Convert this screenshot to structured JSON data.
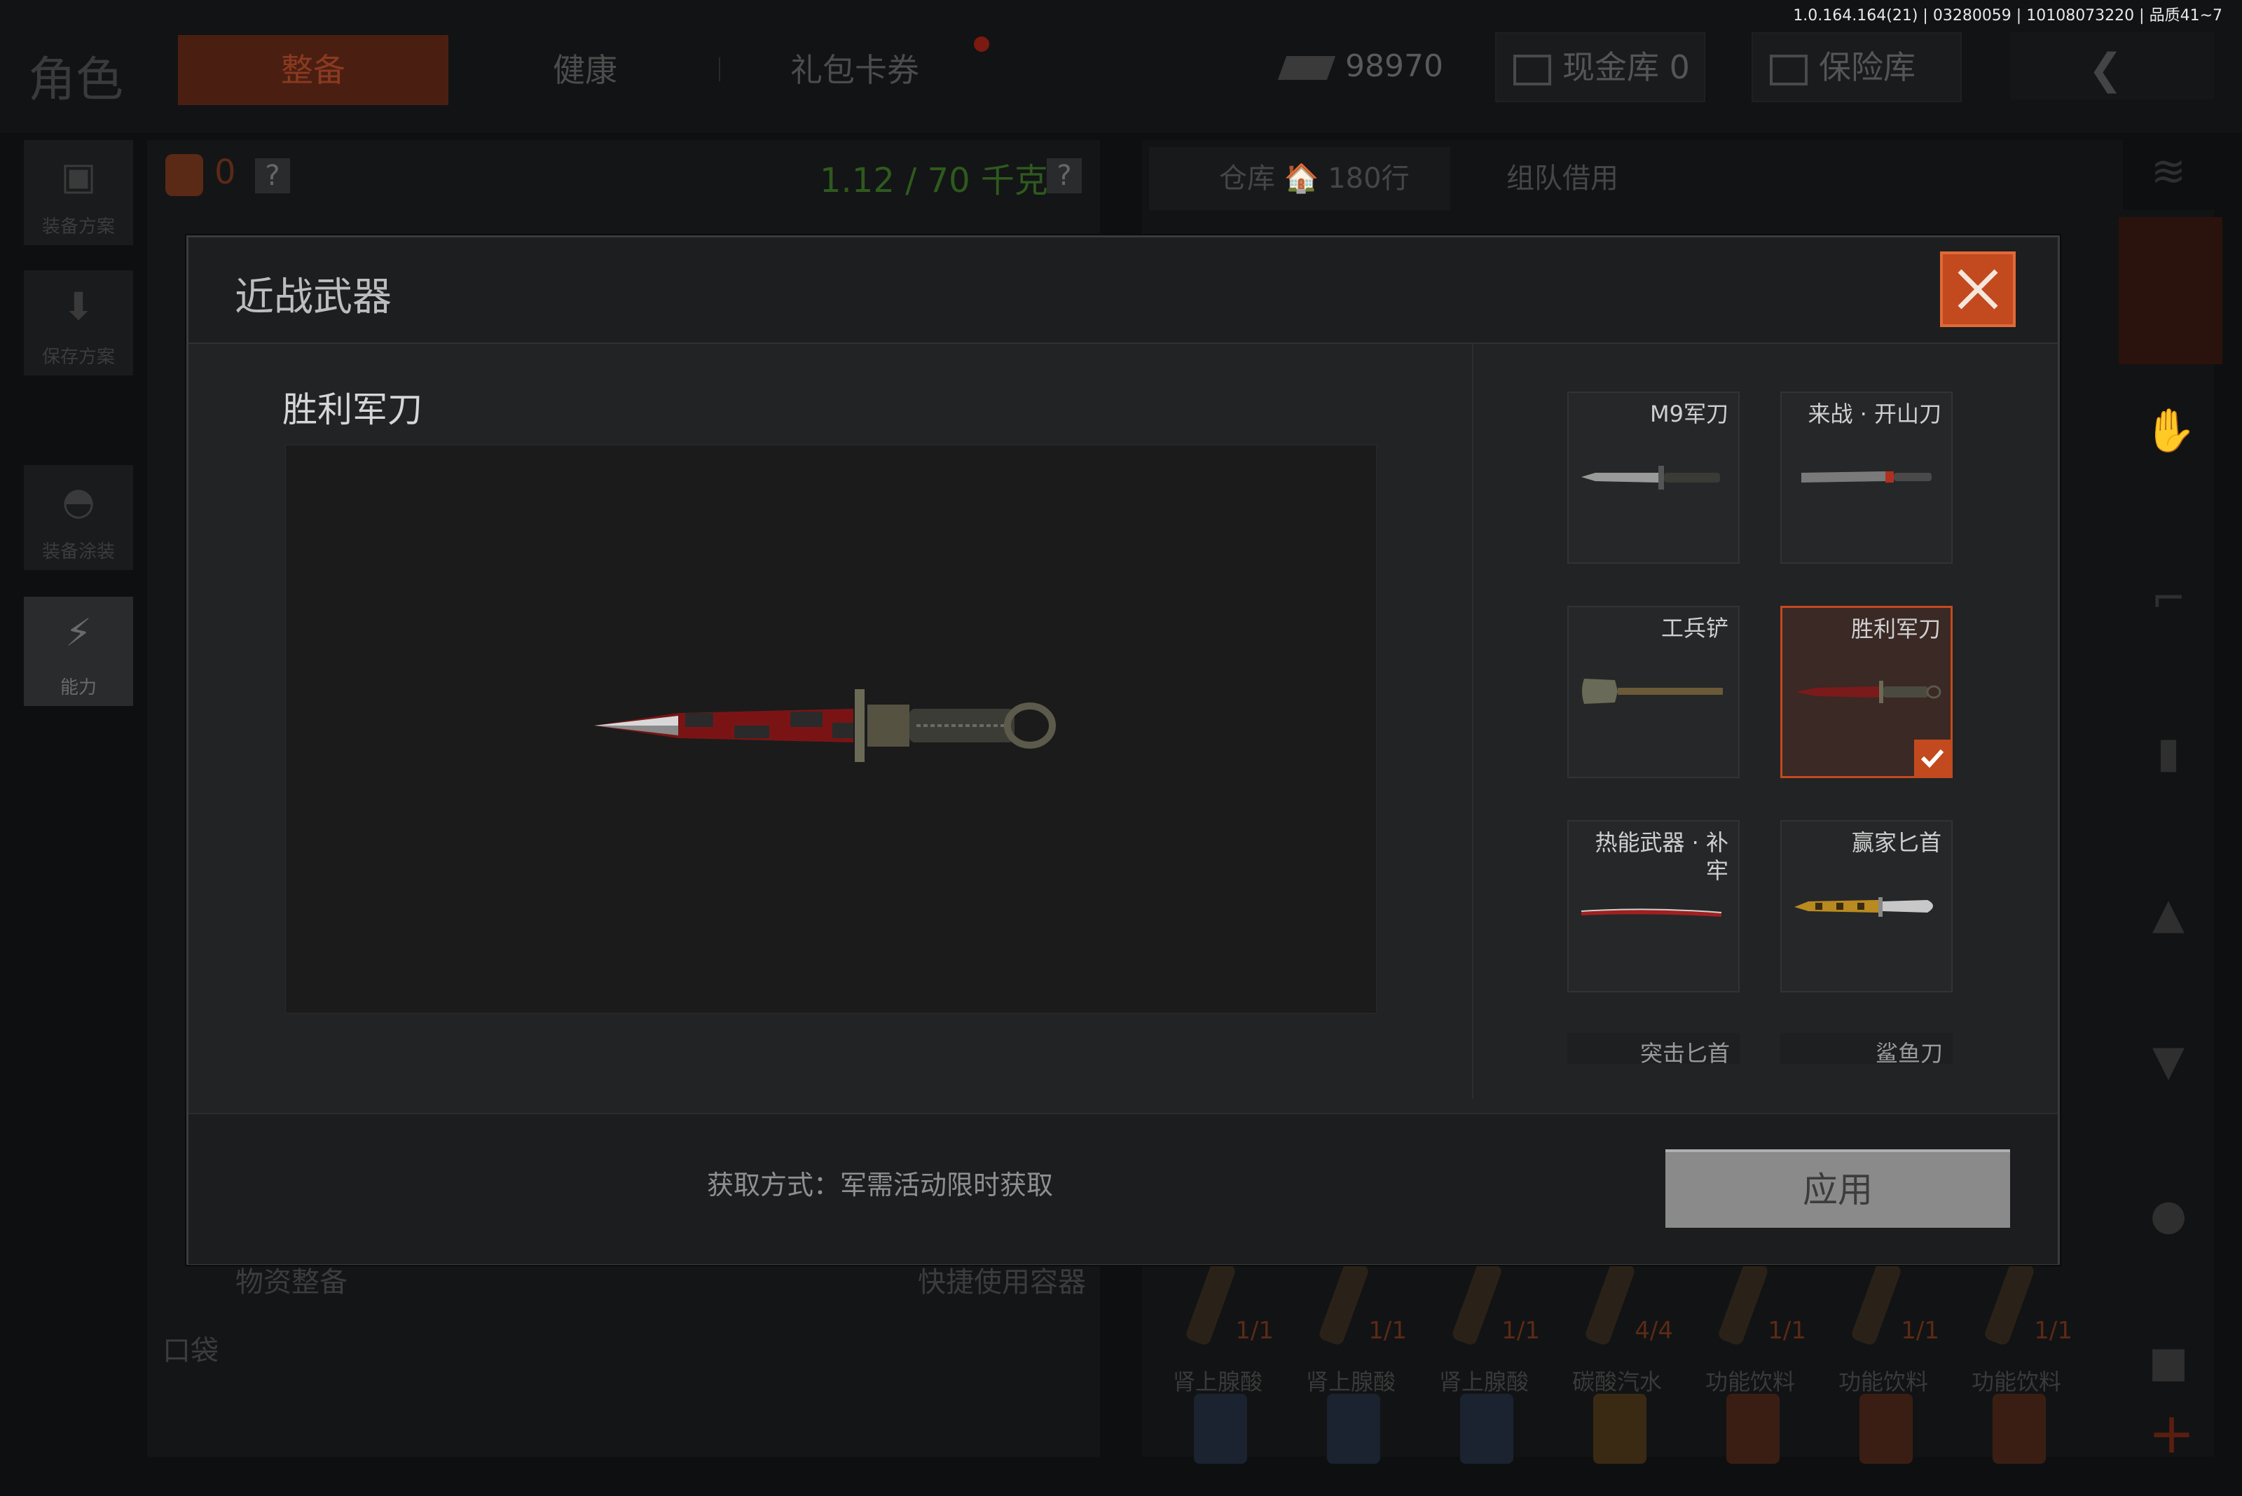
{
  "version_info": "1.0.164.164(21) | 03280059 | 10108073220 | 品质41~7",
  "header": {
    "role_title": "角色",
    "tabs": [
      {
        "label": "整备",
        "active": true
      },
      {
        "label": "健康",
        "active": false
      },
      {
        "label": "礼包卡券",
        "active": false
      }
    ],
    "money": "98970",
    "cash_vault": "现金库 0",
    "safe_box": "保险库"
  },
  "left_sidebar": {
    "items": [
      {
        "label": "装备方案",
        "icon": "vest-icon"
      },
      {
        "label": "保存方案",
        "icon": "download-icon"
      },
      {
        "label": "装备涂装",
        "icon": "helmet-icon"
      },
      {
        "label": "能力",
        "icon": "lightning-icon"
      }
    ]
  },
  "equipment": {
    "bag_count": "0",
    "help": "?",
    "weight": "1.12 / 70 千克",
    "supply_label": "物资整备",
    "quick_container": "快捷使用容器",
    "pocket_label": "口袋"
  },
  "warehouse": {
    "tabs": [
      "仓库 🏠 180行",
      "组队借用"
    ],
    "supply_counts": [
      "1/1",
      "1/1",
      "1/1",
      "4/4",
      "1/1",
      "1/1",
      "1/1"
    ],
    "drinks": [
      "肾上腺酸",
      "肾上腺酸",
      "肾上腺酸",
      "碳酸汽水",
      "功能饮料",
      "功能饮料",
      "功能饮料"
    ]
  },
  "modal": {
    "title": "近战武器",
    "selected_weapon": "胜利军刀",
    "weapons": [
      {
        "name": "M9军刀",
        "selected": false
      },
      {
        "name": "来战 · 开山刀",
        "selected": false
      },
      {
        "name": "工兵铲",
        "selected": false
      },
      {
        "name": "胜利军刀",
        "selected": true
      },
      {
        "name": "热能武器 · 补牢",
        "selected": false
      },
      {
        "name": "赢家匕首",
        "selected": false
      },
      {
        "name": "突击匕首",
        "selected": false
      },
      {
        "name": "鲨鱼刀",
        "selected": false
      }
    ],
    "acquire_text": "获取方式：军需活动限时获取",
    "apply_label": "应用"
  },
  "colors": {
    "accent": "#c24a1e",
    "panel": "#222324",
    "weight_green": "#2e5a1e"
  }
}
